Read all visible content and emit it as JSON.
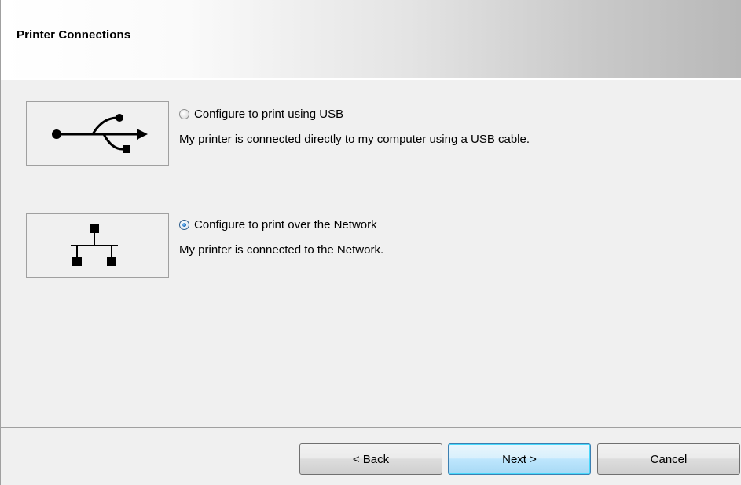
{
  "header": {
    "title": "Printer Connections"
  },
  "options": [
    {
      "icon": "usb-icon",
      "label": "Configure to print using USB",
      "description": "My printer is connected directly to my computer using a USB cable.",
      "selected": false
    },
    {
      "icon": "network-icon",
      "label": "Configure to print over the Network",
      "description": "My printer is connected to the Network.",
      "selected": true
    }
  ],
  "buttons": {
    "back_label": "< Back",
    "next_label": "Next >",
    "cancel_label": "Cancel"
  },
  "colors": {
    "background": "#f0f0f0",
    "default_button_border": "#3c7fb1"
  }
}
